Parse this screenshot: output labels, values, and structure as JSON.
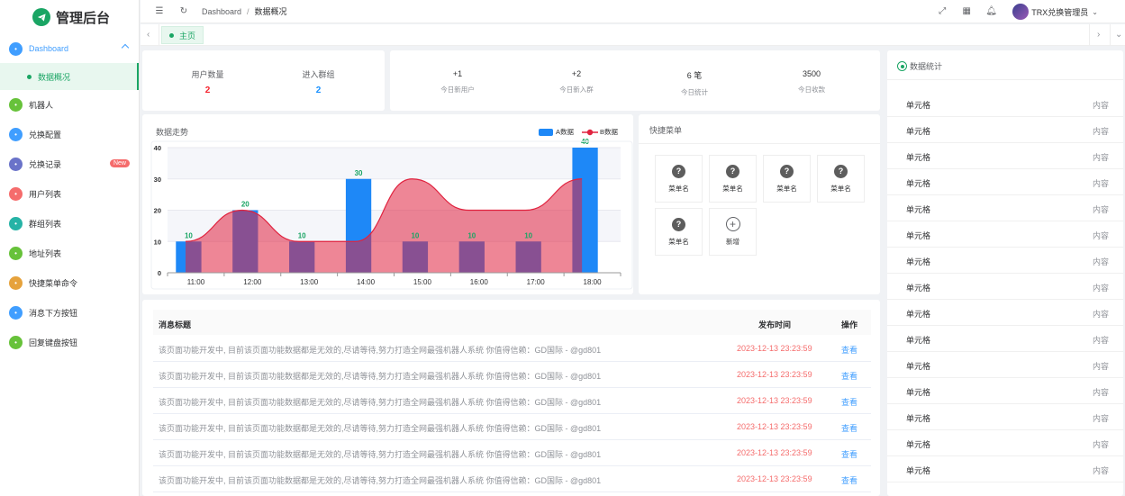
{
  "app": {
    "title": "管理后台"
  },
  "sidebar": {
    "items": [
      {
        "label": "Dashboard",
        "icon": "home-icon",
        "color": "#409eff"
      },
      {
        "label": "机器人",
        "icon": "robot-icon",
        "color": "#67c23a"
      },
      {
        "label": "兑换配置",
        "icon": "gear-icon",
        "color": "#409eff"
      },
      {
        "label": "兑换记录",
        "icon": "record-icon",
        "color": "#6a73c9",
        "badge": "New"
      },
      {
        "label": "用户列表",
        "icon": "user-icon",
        "color": "#f56c6c"
      },
      {
        "label": "群组列表",
        "icon": "group-icon",
        "color": "#26b3a6"
      },
      {
        "label": "地址列表",
        "icon": "address-icon",
        "color": "#67c23a"
      },
      {
        "label": "快捷菜单命令",
        "icon": "menu-command-icon",
        "color": "#e6a23c"
      },
      {
        "label": "消息下方按钮",
        "icon": "message-button-icon",
        "color": "#409eff"
      },
      {
        "label": "回复键盘按钮",
        "icon": "keyboard-icon",
        "color": "#67c23a"
      }
    ],
    "submenu": {
      "label": "数据概况"
    }
  },
  "header": {
    "breadcrumb": [
      "Dashboard",
      "数据概况"
    ],
    "separator": "/",
    "user_name": "TRX兑换管理员"
  },
  "tags": {
    "active": "主页"
  },
  "stats_left": [
    {
      "label": "用户数量",
      "value": "2",
      "color": "#f5222d"
    },
    {
      "label": "进入群组",
      "value": "2",
      "color": "#1890ff"
    }
  ],
  "stats_right": [
    {
      "value": "+1",
      "label": "今日新用户"
    },
    {
      "value": "+2",
      "label": "今日新入群"
    },
    {
      "value": "6 笔",
      "label": "今日统计"
    },
    {
      "value": "3500",
      "label": "今日收款"
    }
  ],
  "chart_card": {
    "title": "数据走势"
  },
  "chart_data": {
    "type": "bar",
    "categories": [
      "11:00",
      "12:00",
      "13:00",
      "14:00",
      "15:00",
      "16:00",
      "17:00",
      "18:00"
    ],
    "series": [
      {
        "name": "A数据",
        "type": "bar",
        "color": "#1e88f7",
        "values": [
          10,
          20,
          10,
          30,
          10,
          10,
          10,
          40
        ]
      },
      {
        "name": "B数据",
        "type": "area",
        "color": "#e0233f",
        "values": [
          10,
          20,
          10,
          10,
          30,
          20,
          20,
          30
        ]
      }
    ],
    "yticks": [
      0,
      10,
      20,
      30,
      40
    ],
    "ylim": [
      0,
      40
    ],
    "data_labels": [
      "10",
      "20",
      "10",
      "30",
      "10",
      "10",
      "10",
      "40"
    ],
    "legend_position": "top-right",
    "grid": true
  },
  "quick_menu": {
    "title": "快捷菜单",
    "items": [
      "菜单名",
      "菜单名",
      "菜单名",
      "菜单名",
      "菜单名"
    ],
    "add_label": "新增"
  },
  "messages": {
    "headers": [
      "消息标题",
      "发布时间",
      "操作"
    ],
    "rows": [
      {
        "title": "该页面功能开发中, 目前该页面功能数据都是无效的,尽请等待,努力打造全网最强机器人系统 你值得信赖：GD国际 - @gd801",
        "time": "2023-12-13 23:23:59",
        "action": "查看"
      },
      {
        "title": "该页面功能开发中, 目前该页面功能数据都是无效的,尽请等待,努力打造全网最强机器人系统 你值得信赖：GD国际 - @gd801",
        "time": "2023-12-13 23:23:59",
        "action": "查看"
      },
      {
        "title": "该页面功能开发中, 目前该页面功能数据都是无效的,尽请等待,努力打造全网最强机器人系统 你值得信赖：GD国际 - @gd801",
        "time": "2023-12-13 23:23:59",
        "action": "查看"
      },
      {
        "title": "该页面功能开发中, 目前该页面功能数据都是无效的,尽请等待,努力打造全网最强机器人系统 你值得信赖：GD国际 - @gd801",
        "time": "2023-12-13 23:23:59",
        "action": "查看"
      },
      {
        "title": "该页面功能开发中, 目前该页面功能数据都是无效的,尽请等待,努力打造全网最强机器人系统 你值得信赖：GD国际 - @gd801",
        "time": "2023-12-13 23:23:59",
        "action": "查看"
      },
      {
        "title": "该页面功能开发中, 目前该页面功能数据都是无效的,尽请等待,努力打造全网最强机器人系统 你值得信赖：GD国际 - @gd801",
        "time": "2023-12-13 23:23:59",
        "action": "查看"
      }
    ]
  },
  "data_stats": {
    "title": "数据统计",
    "rows": [
      {
        "label": "单元格",
        "value": "内容"
      },
      {
        "label": "单元格",
        "value": "内容"
      },
      {
        "label": "单元格",
        "value": "内容"
      },
      {
        "label": "单元格",
        "value": "内容"
      },
      {
        "label": "单元格",
        "value": "内容"
      },
      {
        "label": "单元格",
        "value": "内容"
      },
      {
        "label": "单元格",
        "value": "内容"
      },
      {
        "label": "单元格",
        "value": "内容"
      },
      {
        "label": "单元格",
        "value": "内容"
      },
      {
        "label": "单元格",
        "value": "内容"
      },
      {
        "label": "单元格",
        "value": "内容"
      },
      {
        "label": "单元格",
        "value": "内容"
      },
      {
        "label": "单元格",
        "value": "内容"
      },
      {
        "label": "单元格",
        "value": "内容"
      },
      {
        "label": "单元格",
        "value": "内容"
      }
    ]
  }
}
